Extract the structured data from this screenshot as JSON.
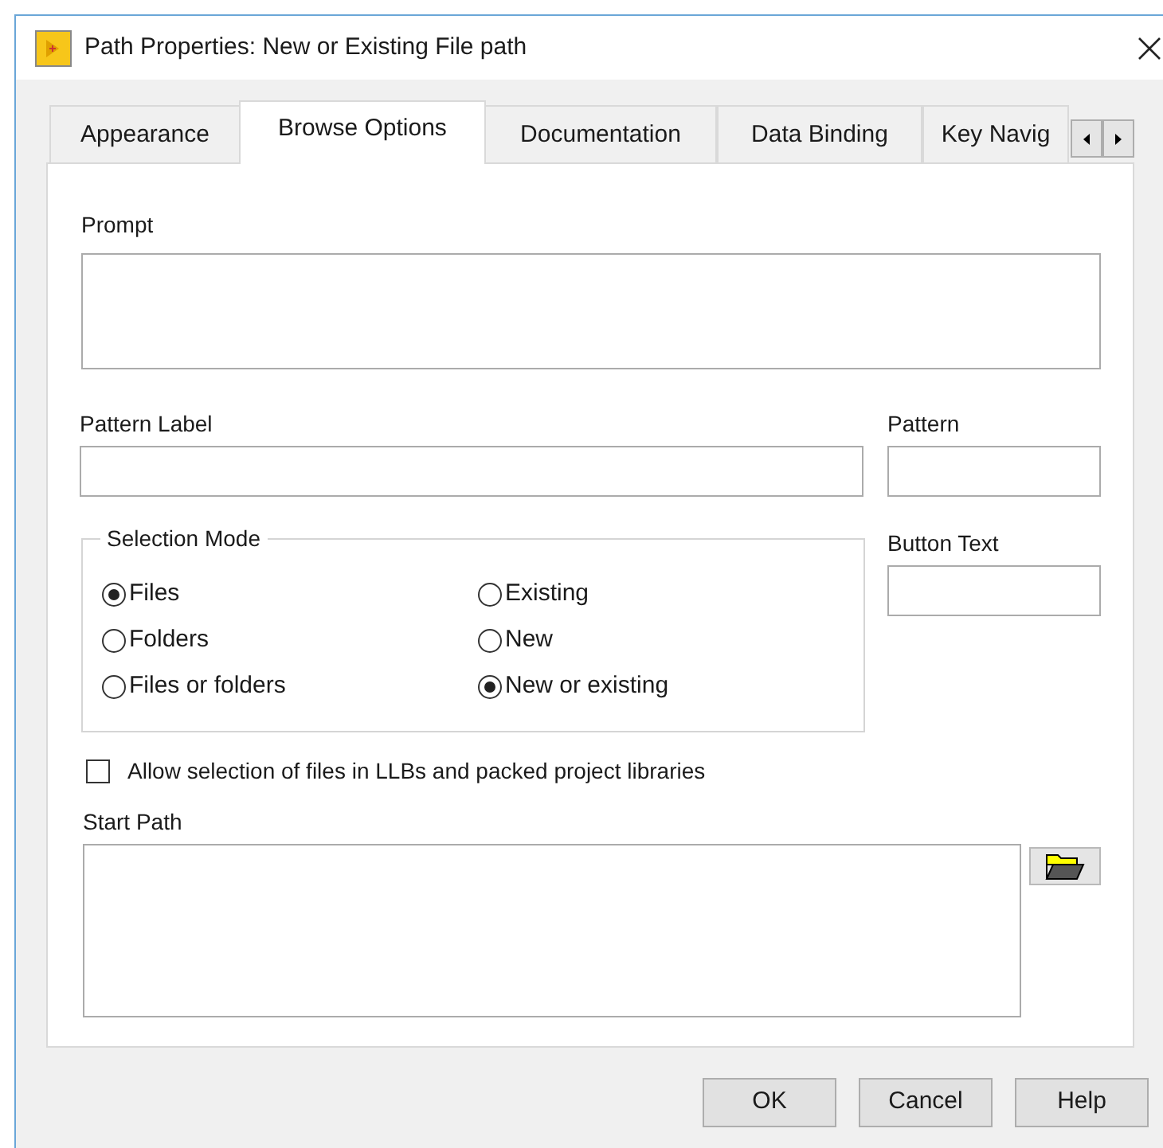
{
  "window": {
    "title": "Path Properties: New or Existing File path"
  },
  "tabs": [
    {
      "label": "Appearance",
      "selected": false
    },
    {
      "label": "Browse Options",
      "selected": true
    },
    {
      "label": "Documentation",
      "selected": false
    },
    {
      "label": "Data Binding",
      "selected": false
    },
    {
      "label": "Key Navig",
      "selected": false
    }
  ],
  "prompt": {
    "label": "Prompt"
  },
  "pattern_label": {
    "label": "Pattern Label"
  },
  "pattern": {
    "label": "Pattern"
  },
  "button_text": {
    "label": "Button Text"
  },
  "selection_mode": {
    "label": "Selection Mode",
    "options": [
      {
        "label": "Files",
        "selected": true
      },
      {
        "label": "Existing",
        "selected": false
      },
      {
        "label": "Folders",
        "selected": false
      },
      {
        "label": "New",
        "selected": false
      },
      {
        "label": "Files or folders",
        "selected": false
      },
      {
        "label": "New or existing",
        "selected": true
      }
    ]
  },
  "allow_llb": {
    "label": "Allow selection of files in LLBs and packed project libraries",
    "checked": false
  },
  "start_path": {
    "label": "Start Path"
  },
  "buttons": [
    "OK",
    "Cancel",
    "Help"
  ]
}
